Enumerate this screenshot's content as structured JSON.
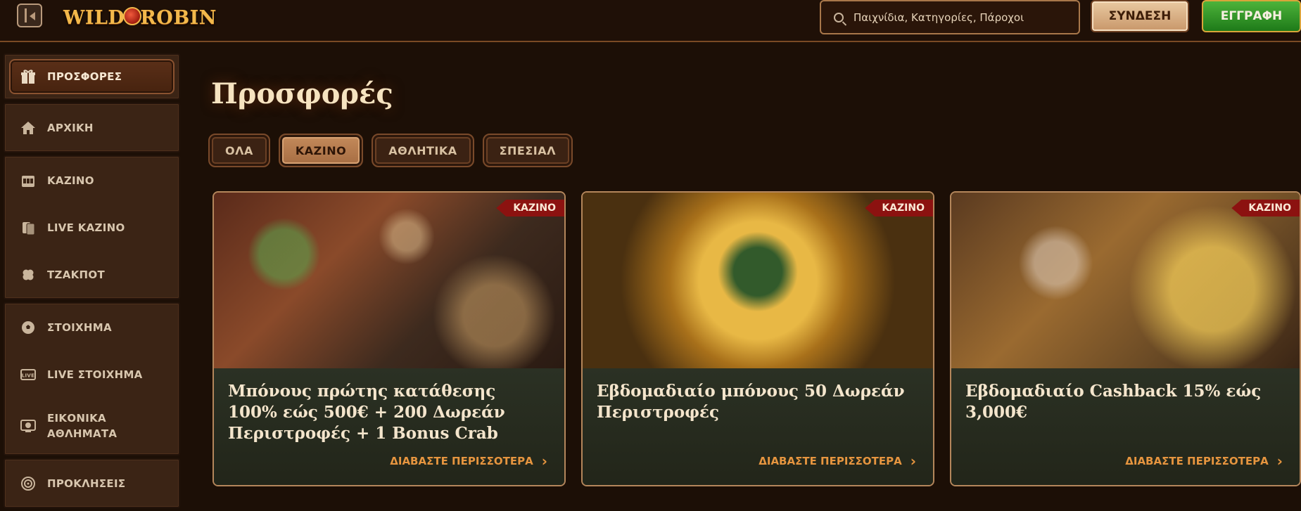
{
  "header": {
    "logo_text_left": "WILD",
    "logo_text_right": "ROBIN",
    "search_placeholder": "Παιχνίδια, Κατηγορίες, Πάροχοι",
    "login_label": "ΣΥΝΔΕΣΗ",
    "register_label": "ΕΓΓΡΑΦΗ"
  },
  "sidebar": {
    "groups": [
      [
        {
          "label": "ΠΡΟΣΦΟΡΕΣ",
          "icon": "gift-icon",
          "active": true
        }
      ],
      [
        {
          "label": "ΑΡΧΙΚΗ",
          "icon": "home-icon"
        }
      ],
      [
        {
          "label": "ΚΑΖΙΝΟ",
          "icon": "slot-machine-icon"
        },
        {
          "label": "LIVE ΚΑΖΙΝΟ",
          "icon": "cards-icon"
        },
        {
          "label": "ΤΖΑΚΠΟΤ",
          "icon": "clover-icon"
        }
      ],
      [
        {
          "label": "ΣΤΟΙΧΗΜΑ",
          "icon": "football-icon"
        },
        {
          "label": "LIVE ΣΤΟΙΧΗΜΑ",
          "icon": "live-icon"
        },
        {
          "label": "ΕΙΚΟΝΙΚΑ ΑΘΛΗΜΑΤΑ",
          "icon": "virtual-sports-icon"
        }
      ],
      [
        {
          "label": "ΠΡΟΚΛΗΣΕΙΣ",
          "icon": "target-icon"
        }
      ]
    ]
  },
  "main": {
    "title": "Προσφορές",
    "tabs": [
      "ΟΛΑ",
      "ΚΑΖΙΝΟ",
      "ΑΘΛΗΤΙΚΑ",
      "ΣΠΕΣΙΑΛ"
    ],
    "active_tab": "ΚΑΖΙΝΟ",
    "cards": [
      {
        "badge": "ΚΑΖΙΝΟ",
        "title": "Μπόνους πρώτης κατάθεσης 100% εώς 500€ + 200 Δωρεάν Περιστροφές + 1 Bonus Crab",
        "more": "ΔΙΑΒΑΣΤΕ ΠΕΡΙΣΣΟΤΕΡΑ"
      },
      {
        "badge": "ΚΑΖΙΝΟ",
        "title": "Εβδομαδιαίο μπόνους 50 Δωρεάν Περιστροφές",
        "more": "ΔΙΑΒΑΣΤΕ ΠΕΡΙΣΣΟΤΕΡΑ"
      },
      {
        "badge": "ΚΑΖΙΝΟ",
        "title": "Εβδομαδιαίο Cashback 15% εώς 3,000€",
        "more": "ΔΙΑΒΑΣΤΕ ΠΕΡΙΣΣΟΤΕΡΑ"
      }
    ]
  },
  "colors": {
    "background": "#1c0f06",
    "accent_orange": "#e6953f",
    "badge_red": "#8c1210",
    "register_green": "#2f9a26"
  }
}
